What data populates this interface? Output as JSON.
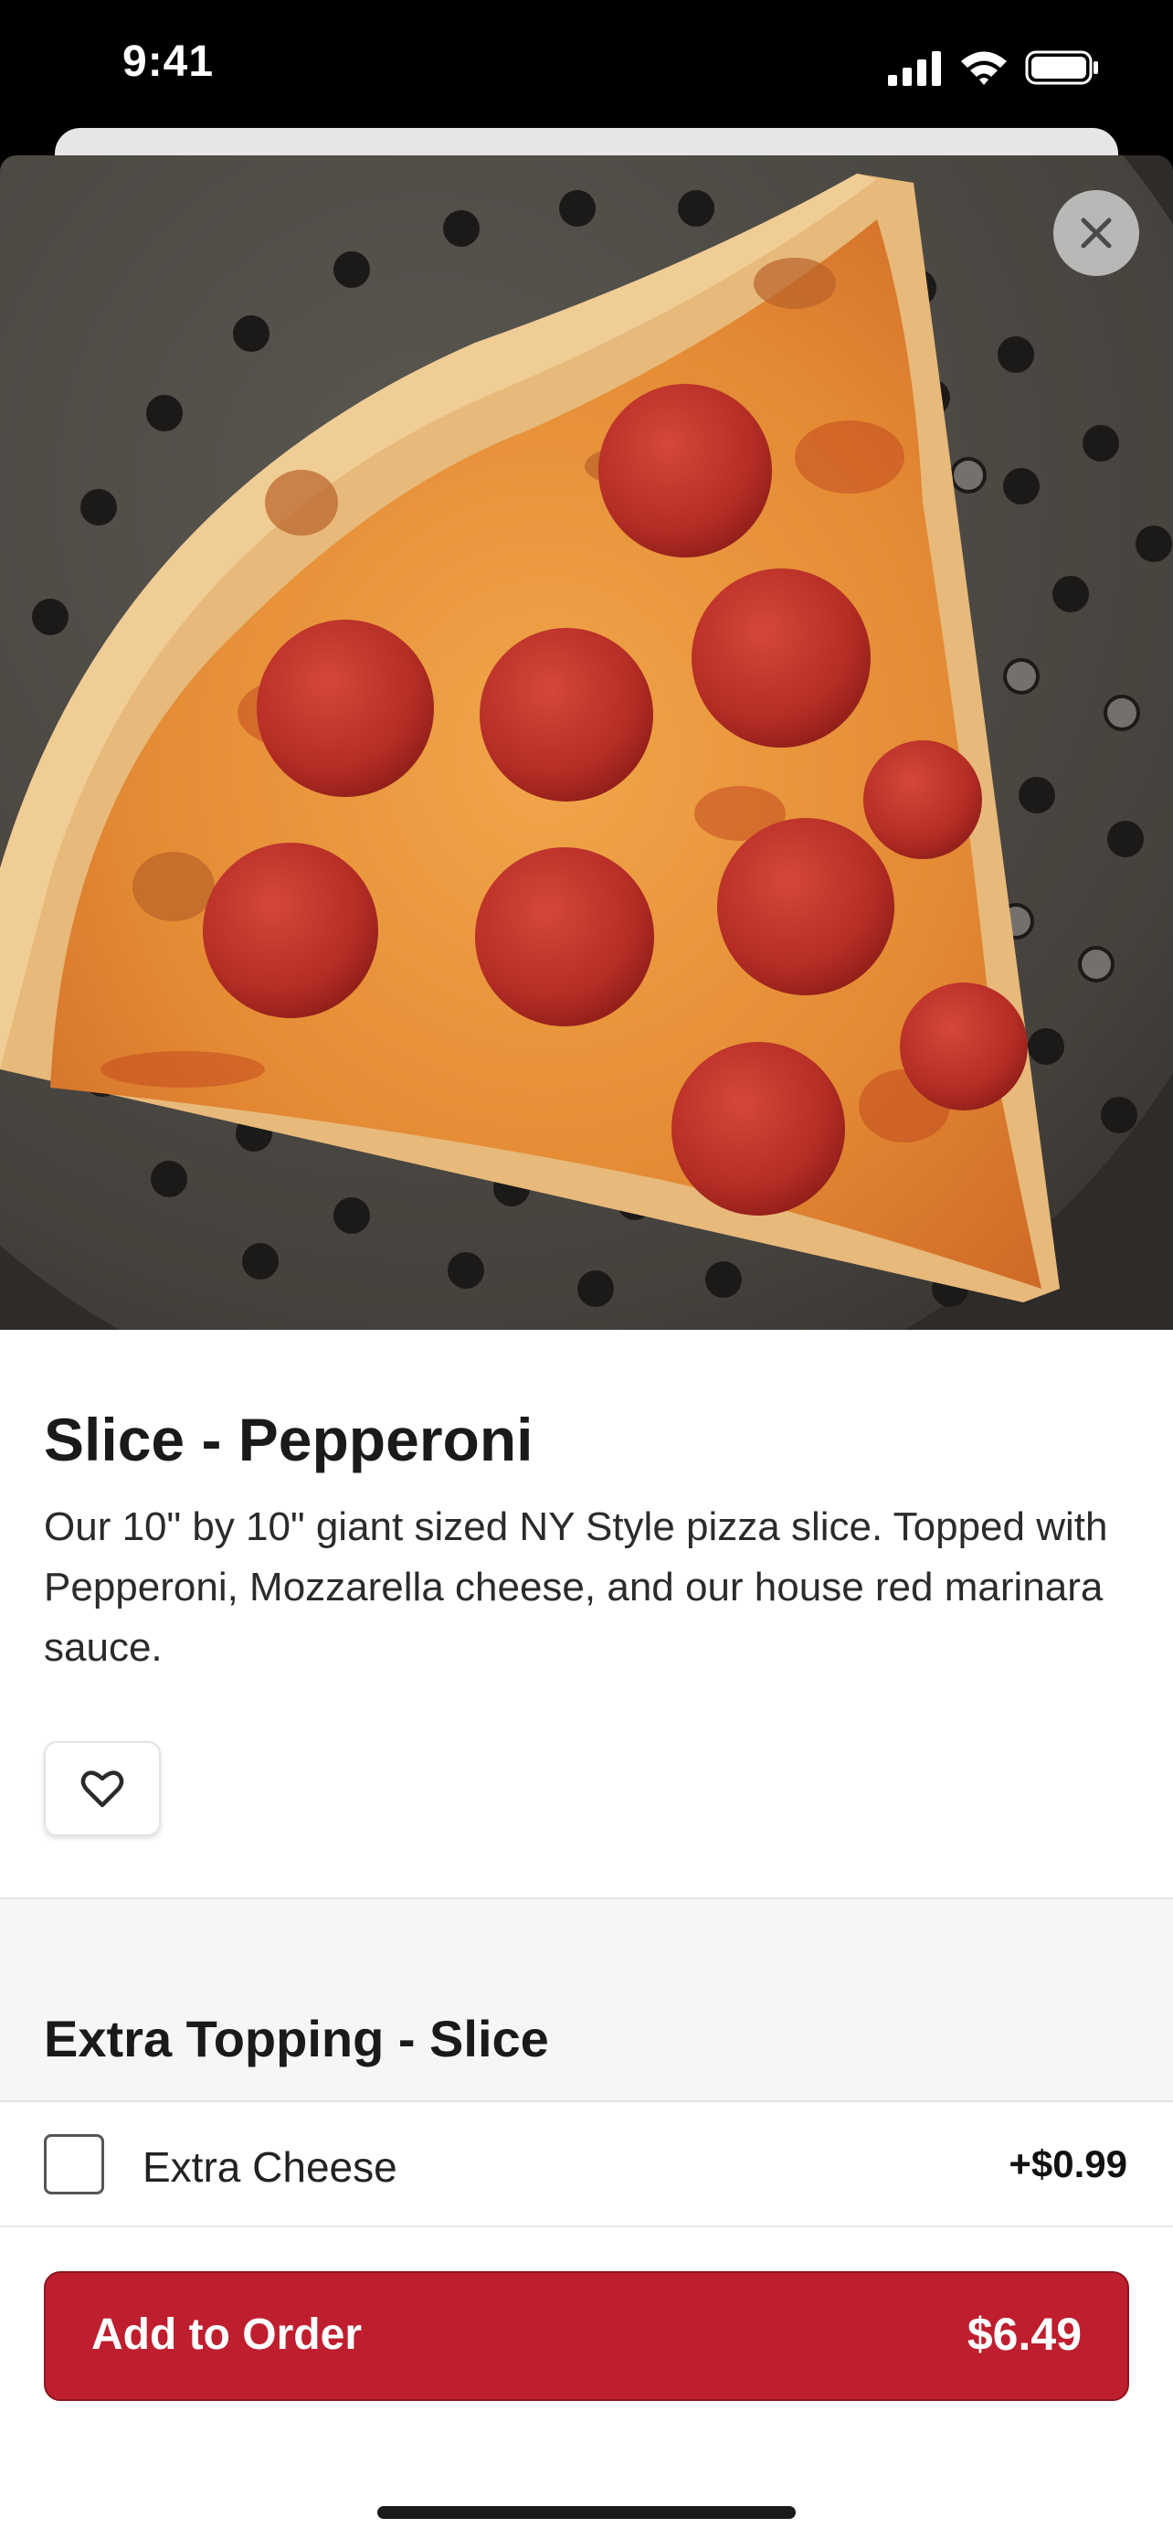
{
  "status_bar": {
    "time": "9:41",
    "signal_icon": "signal-bars-icon",
    "wifi_icon": "wifi-icon",
    "battery_icon": "battery-icon"
  },
  "hero": {
    "image": "pepperoni-pizza-slice-photo",
    "close_icon": "close-icon"
  },
  "item": {
    "title": "Slice - Pepperoni",
    "description": "Our 10\" by 10\" giant sized NY Style pizza slice. Topped with Pepperoni, Mozzarella cheese, and our house red marinara sauce.",
    "favorite_icon": "heart-icon"
  },
  "modifiers": {
    "section_title": "Extra Topping - Slice",
    "options": [
      {
        "label": "Extra Cheese",
        "price": "+$0.99",
        "checked": false
      }
    ]
  },
  "footer": {
    "add_label": "Add to Order",
    "price": "$6.49"
  },
  "colors": {
    "accent": "#bf1e2e",
    "section_bg": "#f6f6f6"
  }
}
